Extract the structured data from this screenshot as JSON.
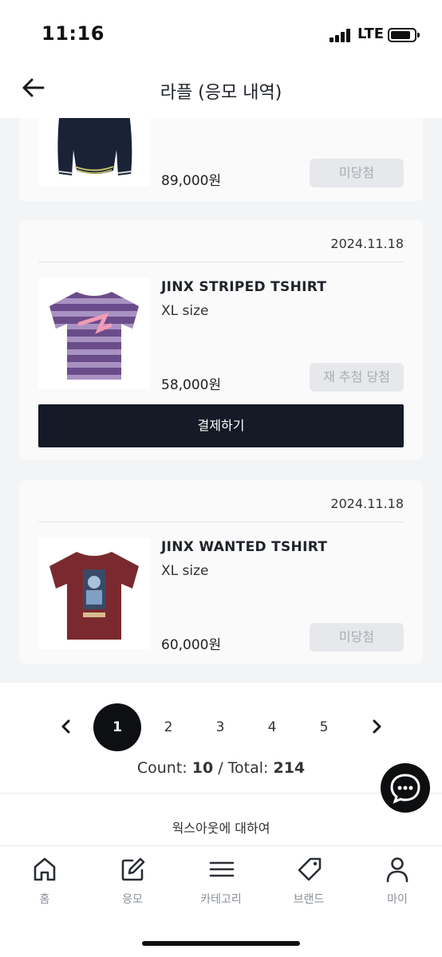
{
  "status_bar": {
    "time": "11:16",
    "network": "LTE"
  },
  "header": {
    "title": "라플 (응모 내역)"
  },
  "entries": [
    {
      "price": "89,000원",
      "status": "미당첨",
      "image": "navy-sweater"
    },
    {
      "date": "2024.11.18",
      "name": "JINX STRIPED TSHIRT",
      "size": "XL size",
      "price": "58,000원",
      "status": "재 추첨 당첨",
      "action": "결제하기",
      "image": "purple-striped-tshirt"
    },
    {
      "date": "2024.11.18",
      "name": "JINX WANTED TSHIRT",
      "size": "XL size",
      "price": "60,000원",
      "status": "미당첨",
      "image": "burgundy-wanted-tshirt"
    }
  ],
  "pagination": {
    "pages": [
      "1",
      "2",
      "3",
      "4",
      "5"
    ],
    "current": "1",
    "count_label": "Count: ",
    "count_value": "10",
    "total_label": " / Total: ",
    "total_value": "214"
  },
  "footer": {
    "about": "웍스아웃에 대하여"
  },
  "tabbar": {
    "items": [
      {
        "label": "홈",
        "icon": "home-icon"
      },
      {
        "label": "응모",
        "icon": "edit-icon"
      },
      {
        "label": "카테고리",
        "icon": "menu-icon"
      },
      {
        "label": "브랜드",
        "icon": "tag-icon"
      },
      {
        "label": "마이",
        "icon": "person-icon"
      }
    ]
  },
  "colors": {
    "primary_button": "#141a26",
    "active_page": "#0e0f12",
    "disabled_pill": "#e6e8eb",
    "background": "#f3f4f6"
  }
}
